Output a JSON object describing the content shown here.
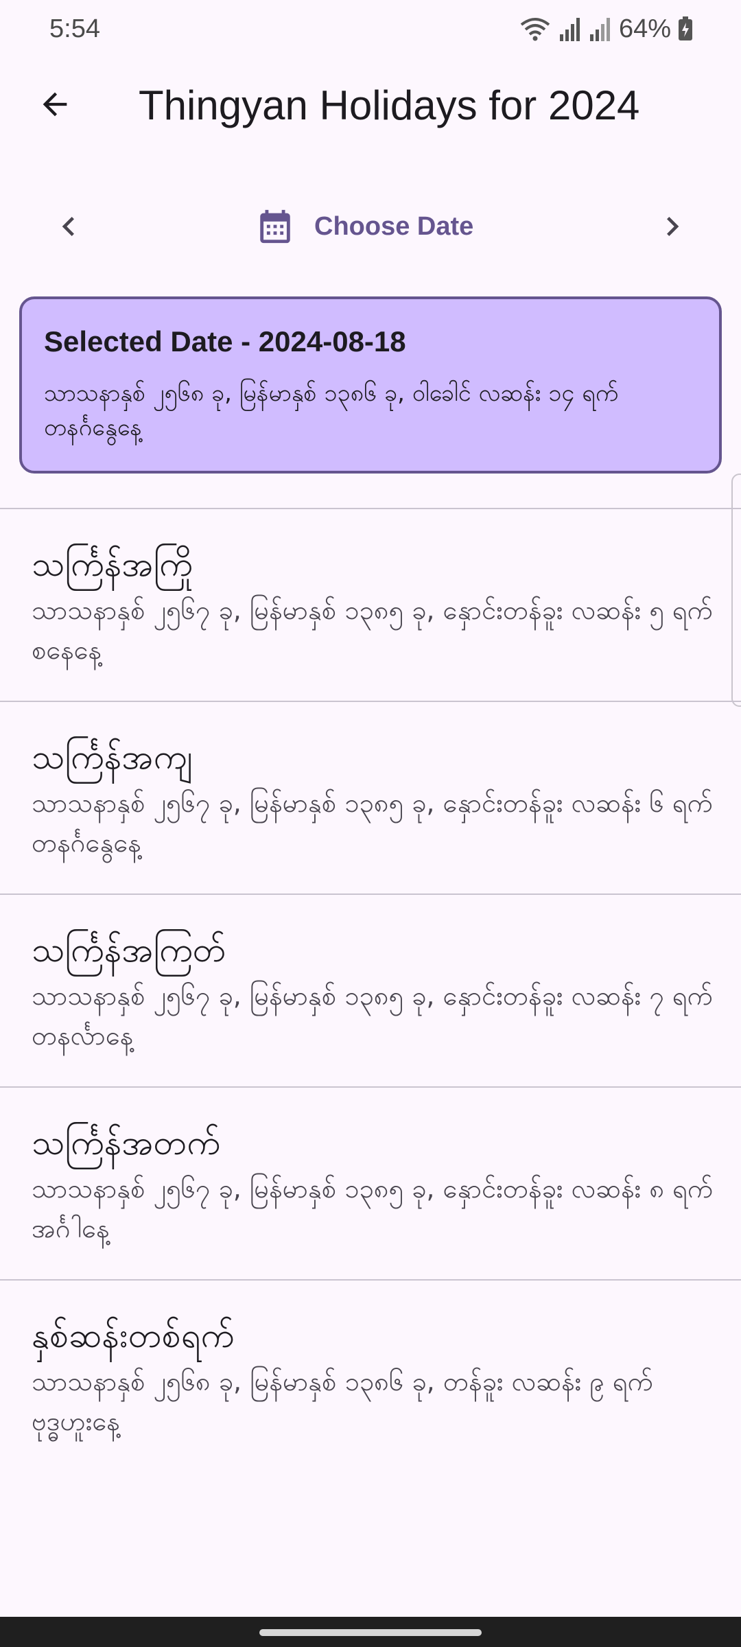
{
  "status_bar": {
    "time": "5:54",
    "battery_percent": "64%",
    "icons": [
      "wifi-icon",
      "signal-icon",
      "signal-icon",
      "battery-icon"
    ]
  },
  "app_bar": {
    "title": "Thingyan Holidays for 2024",
    "back_icon": "arrow-back-icon"
  },
  "date_nav": {
    "choose_label": "Choose Date",
    "prev_icon": "chevron-left-icon",
    "next_icon": "chevron-right-icon",
    "calendar_icon": "calendar-icon"
  },
  "selected": {
    "title": "Selected Date - 2024-08-18",
    "description": "သာသနာနှစ် ၂၅၆၈ ခု, မြန်မာနှစ် ၁၃၈၆ ခု, ဝါခေါင် လဆန်း ၁၄ ရက် တနင်္ဂနွေနေ့"
  },
  "holidays": [
    {
      "name": "သင်္ကြန်အကြို",
      "description": "သာသနာနှစ် ၂၅၆၇ ခု, မြန်မာနှစ် ၁၃၈၅ ခု, နှောင်းတန်ခူး လဆန်း ၅ ရက် စနေနေ့"
    },
    {
      "name": "သင်္ကြန်အကျ",
      "description": "သာသနာနှစ် ၂၅၆၇ ခု, မြန်မာနှစ် ၁၃၈၅ ခု, နှောင်းတန်ခူး လဆန်း ၆ ရက် တနင်္ဂနွေနေ့"
    },
    {
      "name": "သင်္ကြန်အကြတ်",
      "description": "သာသနာနှစ် ၂၅၆၇ ခု, မြန်မာနှစ် ၁၃၈၅ ခု, နှောင်းတန်ခူး လဆန်း ၇ ရက် တနင်္လာနေ့"
    },
    {
      "name": "သင်္ကြန်အတက်",
      "description": "သာသနာနှစ် ၂၅၆၇ ခု, မြန်မာနှစ် ၁၃၈၅ ခု, နှောင်းတန်ခူး လဆန်း ၈ ရက် အင်္ဂါနေ့"
    },
    {
      "name": "နှစ်ဆန်းတစ်ရက်",
      "description": "သာသနာနှစ် ၂၅၆၈ ခု, မြန်မာနှစ် ၁၃၈၆ ခု, တန်ခူး လဆန်း ၉ ရက် ဗုဒ္ဓဟူးနေ့"
    }
  ],
  "colors": {
    "background": "#fdf7fe",
    "primary": "#65558f",
    "card": "#d0bcff",
    "divider": "#cac4d0"
  }
}
